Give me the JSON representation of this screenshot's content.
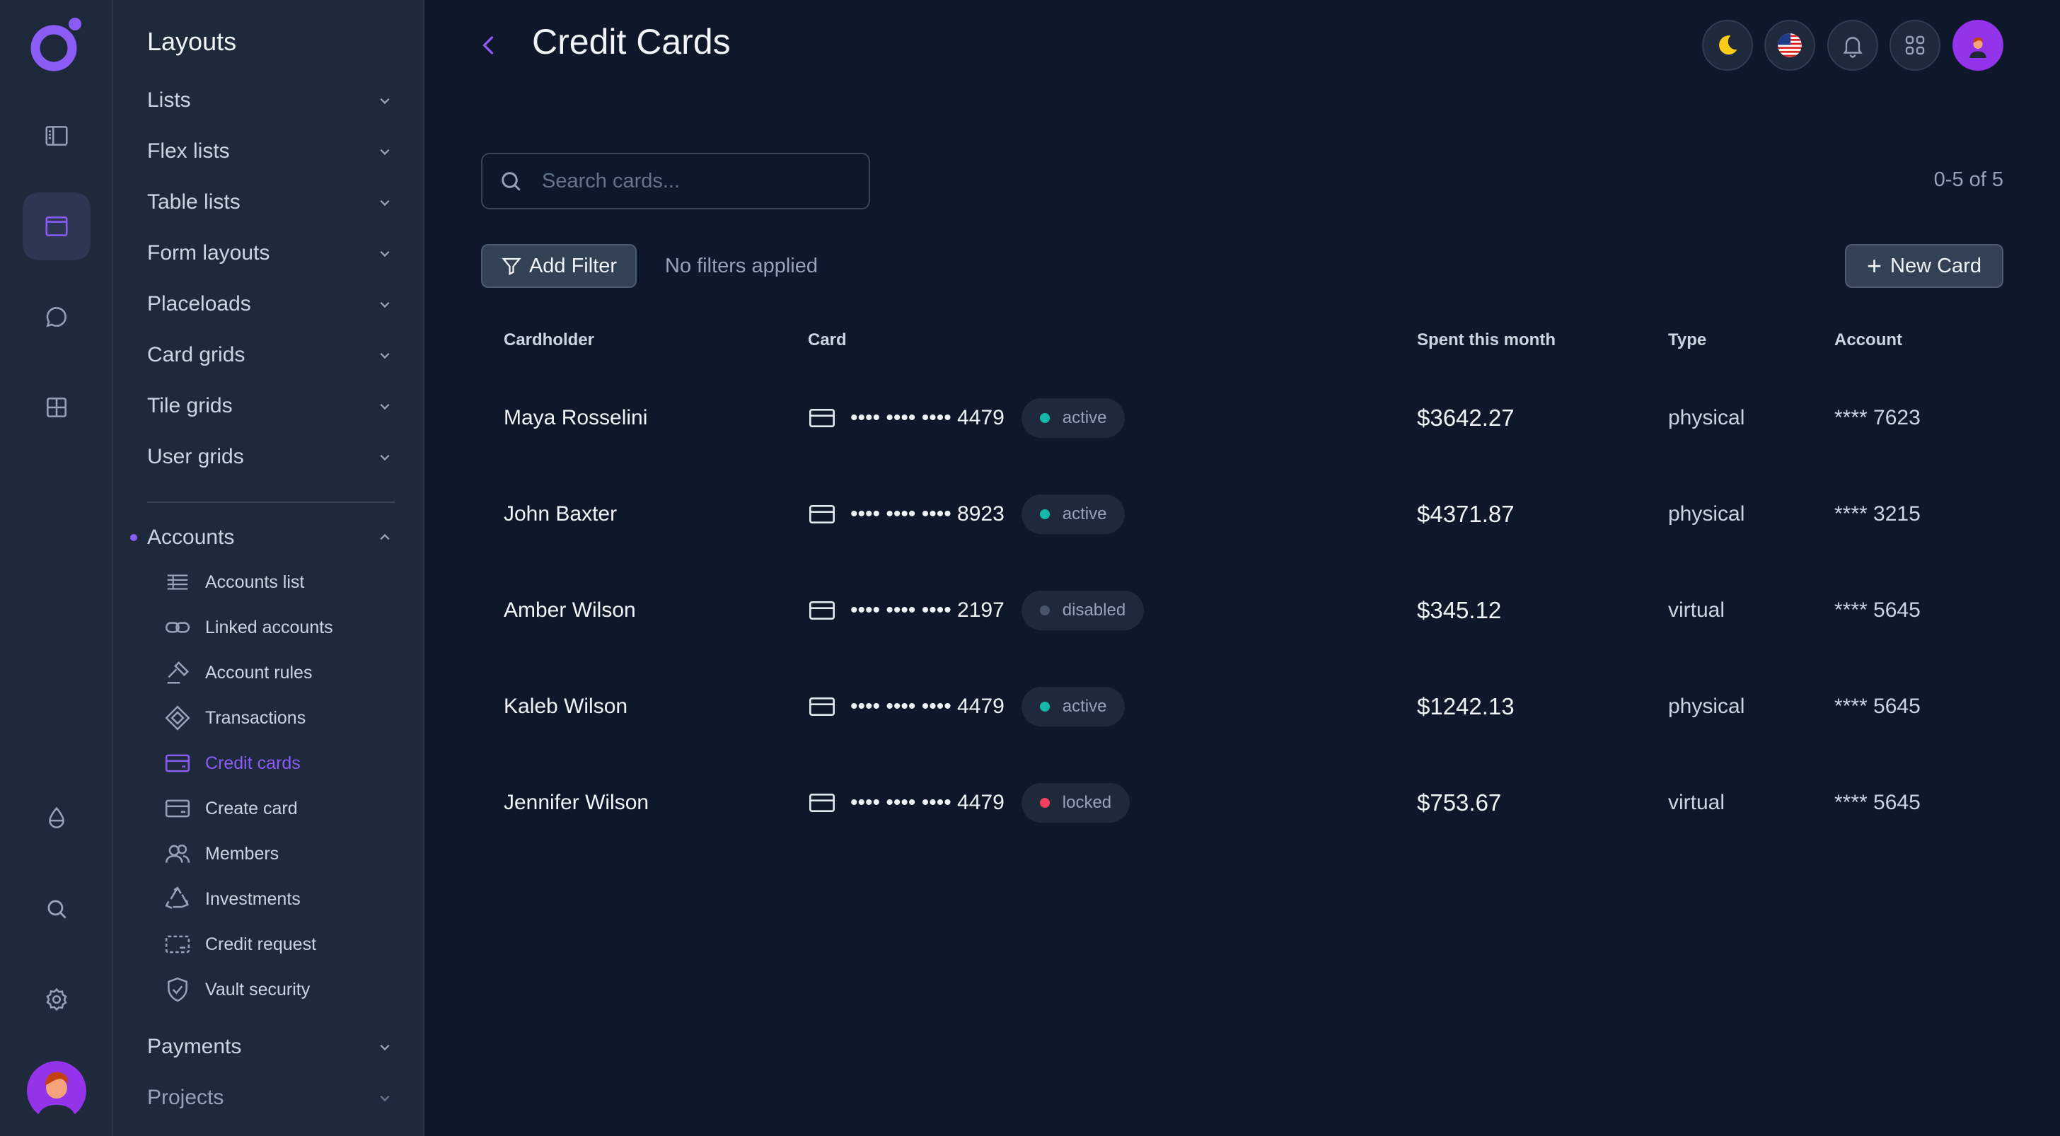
{
  "rail": {
    "icons": [
      "sidebar-icon",
      "window-icon",
      "chat-icon",
      "grid-icon",
      "droplet-icon",
      "search-icon",
      "gear-icon"
    ]
  },
  "panel": {
    "title": "Layouts",
    "groups": [
      {
        "label": "Lists"
      },
      {
        "label": "Flex lists"
      },
      {
        "label": "Table lists"
      },
      {
        "label": "Form layouts"
      },
      {
        "label": "Placeloads"
      },
      {
        "label": "Card grids"
      },
      {
        "label": "Tile grids"
      },
      {
        "label": "User grids"
      }
    ],
    "accounts": {
      "label": "Accounts",
      "items": [
        {
          "label": "Accounts list",
          "icon": "list-lines-icon"
        },
        {
          "label": "Linked accounts",
          "icon": "link-icon"
        },
        {
          "label": "Account rules",
          "icon": "gavel-icon"
        },
        {
          "label": "Transactions",
          "icon": "diamond-arrows-icon"
        },
        {
          "label": "Credit cards",
          "icon": "credit-card-icon"
        },
        {
          "label": "Create card",
          "icon": "card-plus-icon"
        },
        {
          "label": "Members",
          "icon": "users-icon"
        },
        {
          "label": "Investments",
          "icon": "recycle-icon"
        },
        {
          "label": "Credit request",
          "icon": "card-dashed-icon"
        },
        {
          "label": "Vault security",
          "icon": "shield-check-icon"
        }
      ]
    },
    "payments": {
      "label": "Payments"
    },
    "projects": {
      "label": "Projects"
    }
  },
  "header": {
    "title": "Credit Cards"
  },
  "search": {
    "placeholder": "Search cards..."
  },
  "pagination": "0-5 of 5",
  "filters": {
    "add_label": "Add Filter",
    "note": "No filters applied"
  },
  "new_card_label": "New Card",
  "table": {
    "columns": [
      "Cardholder",
      "Card",
      "Spent this month",
      "Type",
      "Account"
    ],
    "rows": [
      {
        "name": "Maya Rosselini",
        "card": "•••• •••• •••• 4479",
        "status": "active",
        "spent": "$3642.27",
        "type": "physical",
        "account": "**** 7623"
      },
      {
        "name": "John Baxter",
        "card": "•••• •••• •••• 8923",
        "status": "active",
        "spent": "$4371.87",
        "type": "physical",
        "account": "**** 3215"
      },
      {
        "name": "Amber Wilson",
        "card": "•••• •••• •••• 2197",
        "status": "disabled",
        "spent": "$345.12",
        "type": "virtual",
        "account": "**** 5645"
      },
      {
        "name": "Kaleb Wilson",
        "card": "•••• •••• •••• 4479",
        "status": "active",
        "spent": "$1242.13",
        "type": "physical",
        "account": "**** 5645"
      },
      {
        "name": "Jennifer Wilson",
        "card": "•••• •••• •••• 4479",
        "status": "locked",
        "spent": "$753.67",
        "type": "virtual",
        "account": "**** 5645"
      }
    ]
  },
  "colors": {
    "accent": "#8b5cf6",
    "active": "#14b8a6",
    "disabled": "#475569",
    "locked": "#f43f5e",
    "background": "#0f172a",
    "panel": "#1e293b"
  }
}
